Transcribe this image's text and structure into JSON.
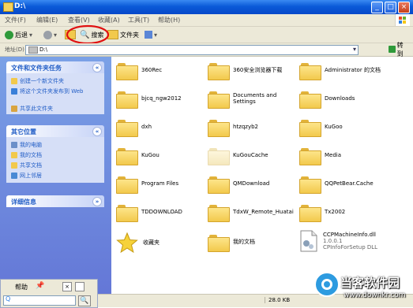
{
  "window": {
    "title": "D:\\"
  },
  "menu": [
    "文件(F)",
    "编辑(E)",
    "查看(V)",
    "收藏(A)",
    "工具(T)",
    "帮助(H)"
  ],
  "toolbar": {
    "back": "后退",
    "search": "搜索",
    "folders": "文件夹"
  },
  "address": {
    "label": "地址(D)",
    "value": "D:\\",
    "go": "转到"
  },
  "sidebar": {
    "tasks_title": "文件和文件夹任务",
    "tasks": [
      "创建一个新文件夹",
      "将这个文件夹发布到 Web",
      "共享此文件夹"
    ],
    "other_title": "其它位置",
    "other": [
      "我的电脑",
      "我的文档",
      "共享文档",
      "网上邻居"
    ],
    "details_title": "详细信息"
  },
  "files": [
    "360Rec",
    "360安全浏览器下载",
    "Administrator 的文档",
    "bjcq_ngw2012",
    "Documents and Settings",
    "Downloads",
    "dxh",
    "htzqzyb2",
    "KuGoo",
    "KuGou",
    "KuGouCache",
    "Media",
    "Program Files",
    "QMDownload",
    "QQPetBear.Cache",
    "TDDOWNLOAD",
    "TdxW_Remote_Huatai",
    "Tx2002",
    "收藏夹",
    "我的文档",
    "CCPMachineInfo.dll",
    "1.0.0.1",
    "CPInfoForSetup DLL"
  ],
  "status": {
    "size": "28.0 KB"
  },
  "help": {
    "label": "帮助"
  },
  "watermark": {
    "brand": "当客软件园",
    "url": "www.downkr.com"
  }
}
